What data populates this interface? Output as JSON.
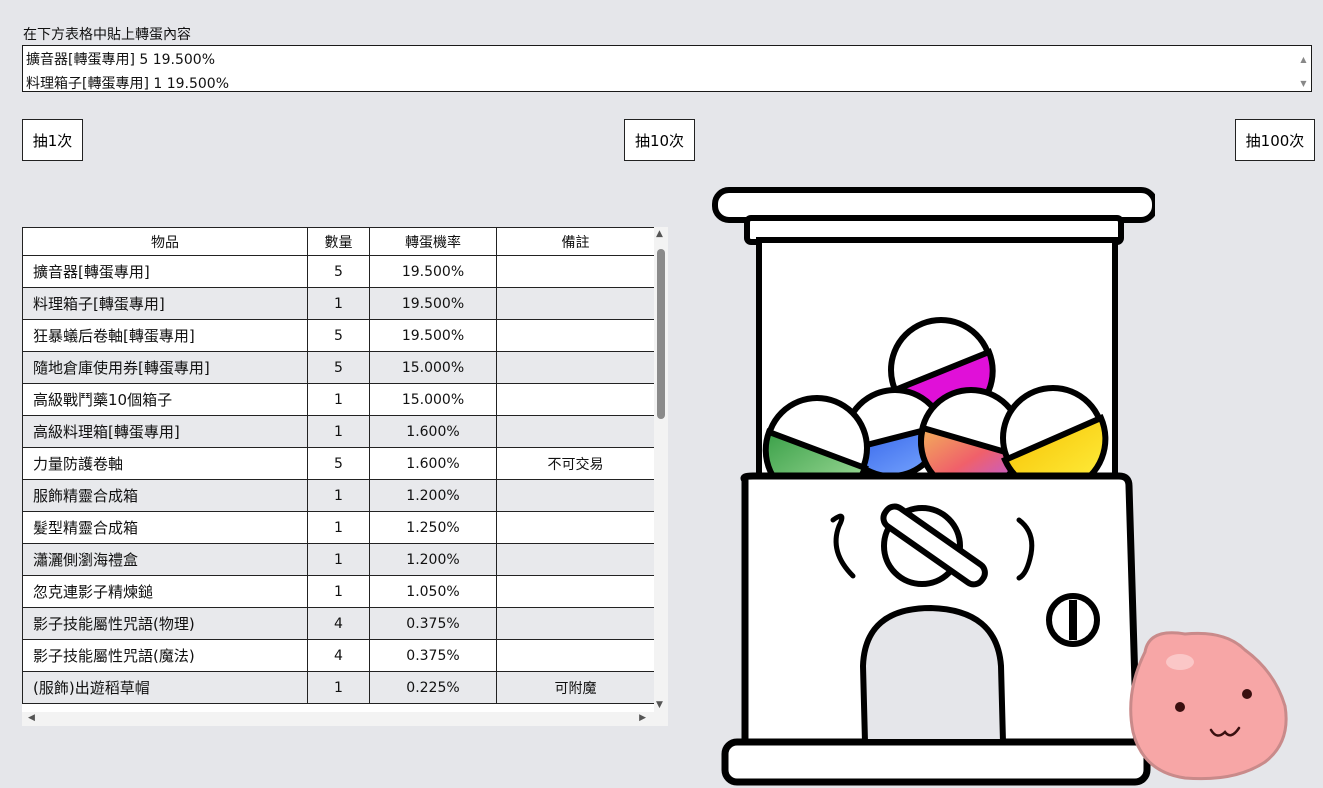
{
  "prompt_label": "在下方表格中貼上轉蛋內容",
  "input_lines": [
    "擴音器[轉蛋專用] 5 19.500%",
    "料理箱子[轉蛋專用] 1 19.500%"
  ],
  "buttons": {
    "draw1": "抽1次",
    "draw10": "抽10次",
    "draw100": "抽100次"
  },
  "table": {
    "headers": [
      "物品",
      "數量",
      "轉蛋機率",
      "備註"
    ],
    "rows": [
      {
        "name": "擴音器[轉蛋專用]",
        "qty": "5",
        "rate": "19.500%",
        "note": ""
      },
      {
        "name": "料理箱子[轉蛋專用]",
        "qty": "1",
        "rate": "19.500%",
        "note": ""
      },
      {
        "name": "狂暴蟻后卷軸[轉蛋專用]",
        "qty": "5",
        "rate": "19.500%",
        "note": ""
      },
      {
        "name": "隨地倉庫使用券[轉蛋專用]",
        "qty": "5",
        "rate": "15.000%",
        "note": ""
      },
      {
        "name": "高級戰鬥藥10個箱子",
        "qty": "1",
        "rate": "15.000%",
        "note": ""
      },
      {
        "name": "高級料理箱[轉蛋專用]",
        "qty": "1",
        "rate": "1.600%",
        "note": ""
      },
      {
        "name": "力量防護卷軸",
        "qty": "5",
        "rate": "1.600%",
        "note": "不可交易"
      },
      {
        "name": "服飾精靈合成箱",
        "qty": "1",
        "rate": "1.200%",
        "note": ""
      },
      {
        "name": "髮型精靈合成箱",
        "qty": "1",
        "rate": "1.250%",
        "note": ""
      },
      {
        "name": "瀟灑側瀏海禮盒",
        "qty": "1",
        "rate": "1.200%",
        "note": ""
      },
      {
        "name": "忽克連影子精煉鎚",
        "qty": "1",
        "rate": "1.050%",
        "note": ""
      },
      {
        "name": "影子技能屬性咒語(物理)",
        "qty": "4",
        "rate": "0.375%",
        "note": ""
      },
      {
        "name": "影子技能屬性咒語(魔法)",
        "qty": "4",
        "rate": "0.375%",
        "note": ""
      },
      {
        "name": "(服飾)出遊稻草帽",
        "qty": "1",
        "rate": "0.225%",
        "note": "可附魔"
      }
    ]
  },
  "colors": {
    "background": "#e5e6ea",
    "ball_magenta": "#e010d8",
    "ball_green": "#5cc060",
    "ball_blue": "#3d7cf0",
    "ball_rainbow": "#f07050",
    "ball_yellow": "#f8d800",
    "slime": "#f7a6a6"
  }
}
